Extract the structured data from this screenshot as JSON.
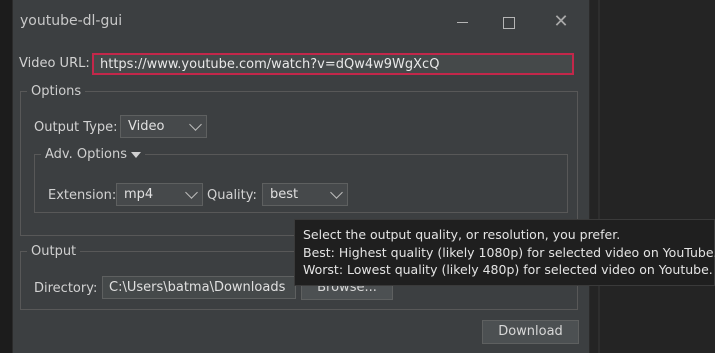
{
  "window": {
    "title": "youtube-dl-gui"
  },
  "url": {
    "label": "Video URL:",
    "value": "https://www.youtube.com/watch?v=dQw4w9WgXcQ"
  },
  "options": {
    "title": "Options",
    "output_type_label": "Output Type:",
    "output_type_value": "Video",
    "adv": {
      "title": "Adv. Options",
      "extension_label": "Extension:",
      "extension_value": "mp4",
      "quality_label": "Quality:",
      "quality_value": "best"
    }
  },
  "output": {
    "title": "Output",
    "directory_label": "Directory:",
    "directory_value": "C:\\Users\\batma\\Downloads",
    "browse_label": "Browse..."
  },
  "download_label": "Download",
  "tooltip": {
    "lines": [
      "Select the output quality, or resolution, you prefer.",
      "Best: Highest quality (likely 1080p) for selected video on YouTube.",
      "Worst: Lowest quality (likely 480p) for selected video on Youtube."
    ]
  },
  "icons": {
    "minimize": "minimize-icon",
    "maximize": "maximize-icon",
    "close": "close-icon",
    "dropdown": "chevron-down-icon",
    "expand": "triangle-down-icon"
  },
  "colors": {
    "window_bg": "#3c3f41",
    "focus_border": "#c3274a",
    "tooltip_bg": "#1f1f1f"
  }
}
